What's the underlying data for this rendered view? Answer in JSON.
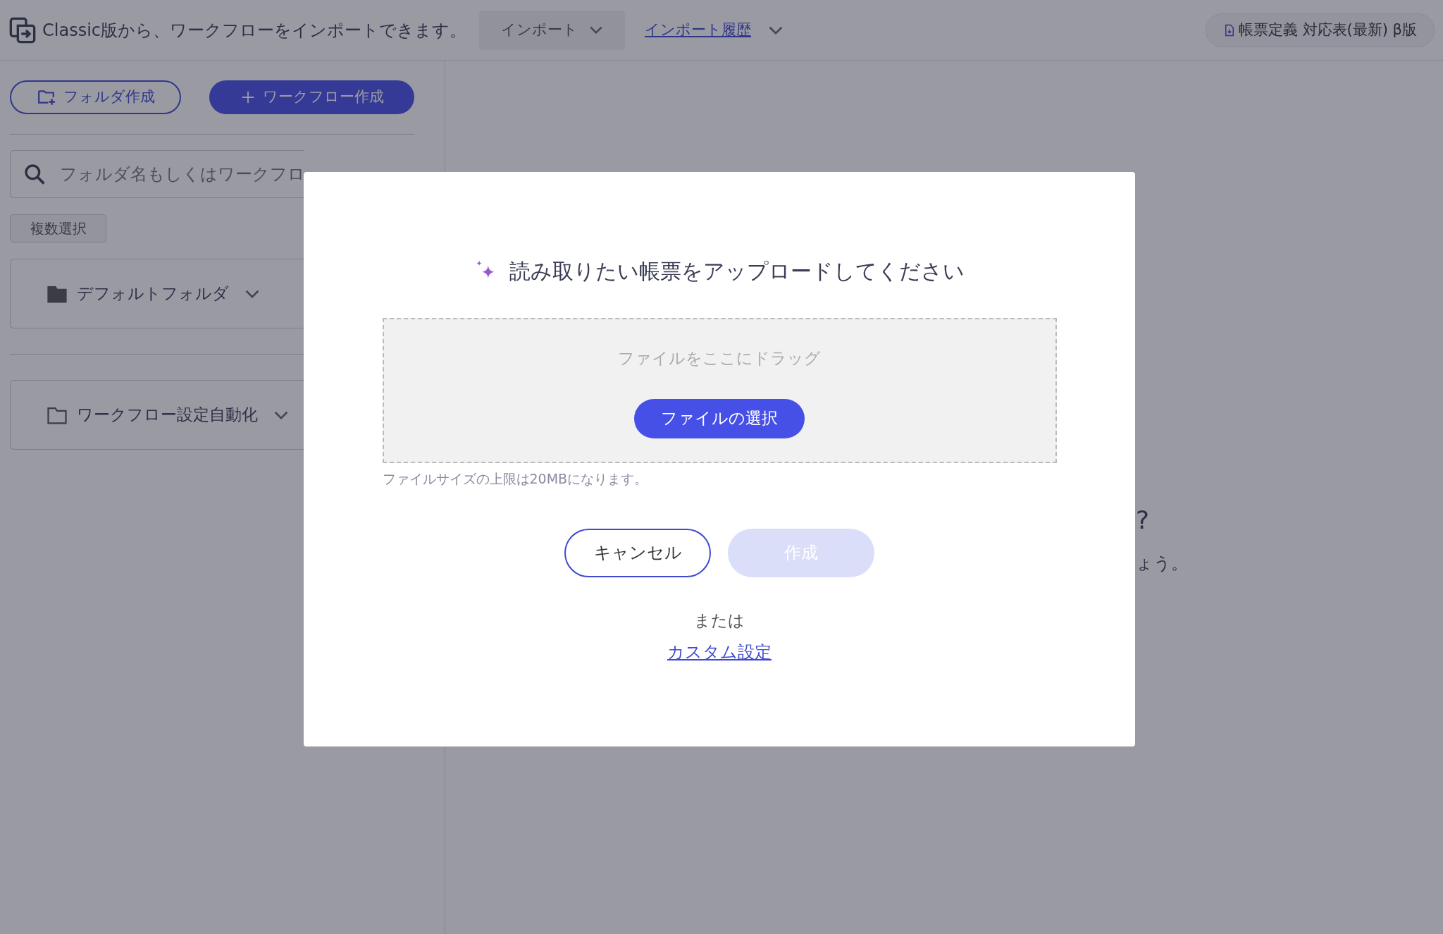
{
  "top_bar": {
    "message": "Classic版から、ワークフローをインポートできます。",
    "import_button": "インポート",
    "history_link": "インポート履歴",
    "doc_link": "帳票定義 対応表(最新) β版"
  },
  "sidebar": {
    "buttons": [
      {
        "label": "フォルダ作成",
        "kind": "outline"
      },
      {
        "label": "ワークフロー作成",
        "kind": "primary"
      }
    ],
    "search": {
      "placeholder": "フォルダ名もしくはワークフロ"
    },
    "multi_select": "複数選択",
    "folders": [
      {
        "name": "デフォルトフォルダ",
        "kind": "filled"
      },
      {
        "name": "ワークフロー設定自動化",
        "kind": "outline"
      }
    ]
  },
  "main": {
    "fragments": [
      "?",
      "ょう。"
    ]
  },
  "modal": {
    "title": "読み取りたい帳票をアップロードしてください",
    "dropzone": {
      "hint": "ファイルをここにドラッグ",
      "button": "ファイルの選択"
    },
    "note": "ファイルサイズの上限は20MBになります。",
    "buttons": [
      {
        "label": "キャンセル",
        "disabled": false
      },
      {
        "label": "作成",
        "disabled": true
      }
    ],
    "or": "または",
    "link": "カスタム設定"
  }
}
